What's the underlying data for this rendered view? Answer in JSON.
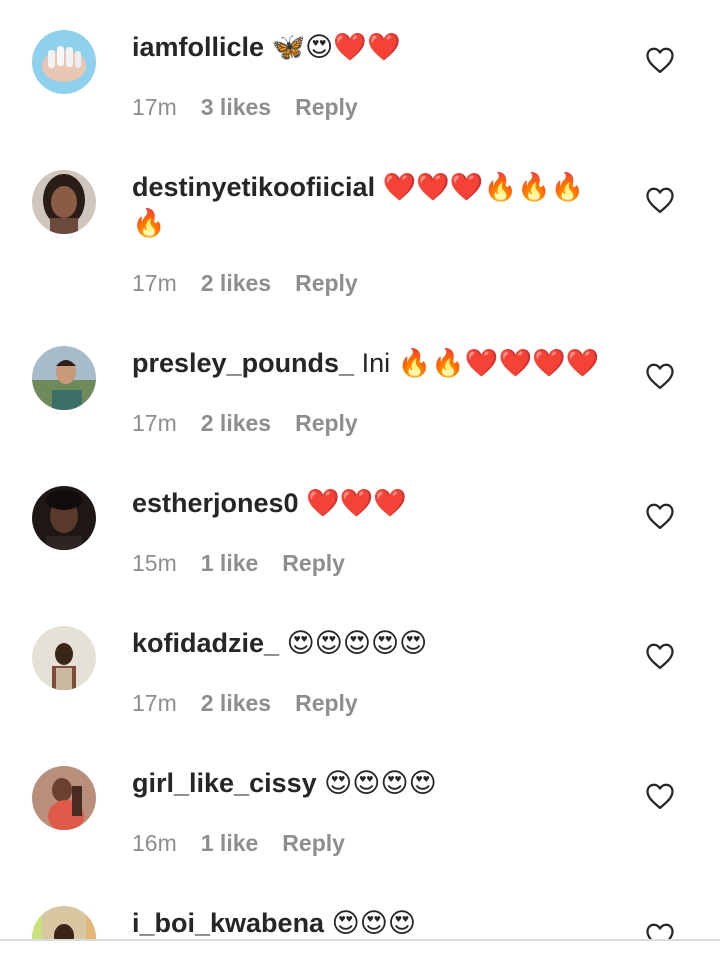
{
  "comments": [
    {
      "username": "iamfollicle",
      "text": "🦋😍❤️❤️",
      "time": "17m",
      "likes": "3 likes",
      "reply": "Reply",
      "avatar_color": "#8fd1ec"
    },
    {
      "username": "destinyetikoofiicial",
      "text": "❤️❤️❤️🔥🔥🔥🔥",
      "time": "17m",
      "likes": "2 likes",
      "reply": "Reply",
      "avatar_color": "#7a5a48"
    },
    {
      "username": "presley_pounds_",
      "text": "Ini 🔥🔥❤️❤️❤️❤️",
      "time": "17m",
      "likes": "2 likes",
      "reply": "Reply",
      "avatar_color": "#8aa1b0"
    },
    {
      "username": "estherjones0",
      "text": "❤️❤️❤️",
      "time": "15m",
      "likes": "1 like",
      "reply": "Reply",
      "avatar_color": "#2c2220"
    },
    {
      "username": "kofidadzie_",
      "text": "😍😍😍😍😍",
      "time": "17m",
      "likes": "2 likes",
      "reply": "Reply",
      "avatar_color": "#d9d4c8"
    },
    {
      "username": "girl_like_cissy",
      "text": "😍😍😍😍",
      "time": "16m",
      "likes": "1 like",
      "reply": "Reply",
      "avatar_color": "#9a6a58"
    },
    {
      "username": "i_boi_kwabena",
      "text": "😍😍😍",
      "time": "",
      "likes": "",
      "reply": "",
      "avatar_color": "#d8c7a0"
    }
  ],
  "colors": {
    "text": "#262626",
    "meta": "#8e8e8e",
    "background": "#ffffff"
  },
  "icons": {
    "like": "heart-outline-icon"
  }
}
